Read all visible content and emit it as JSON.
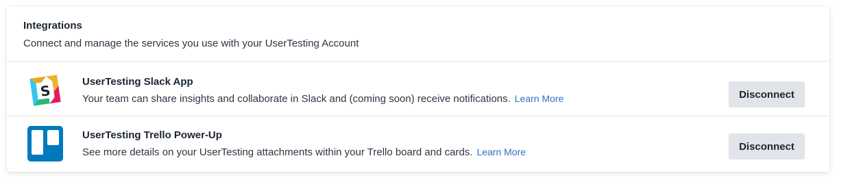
{
  "header": {
    "title": "Integrations",
    "subtitle": "Connect and manage the services you use with your UserTesting Account"
  },
  "integrations": [
    {
      "icon": "slack-icon",
      "title": "UserTesting Slack App",
      "description": "Your team can share insights and collaborate in Slack and (coming soon) receive notifications.",
      "learn_more": "Learn More",
      "action": "Disconnect"
    },
    {
      "icon": "trello-icon",
      "title": "UserTesting Trello Power-Up",
      "description": "See more details on your UserTesting attachments within your Trello board and cards.",
      "learn_more": "Learn More",
      "action": "Disconnect"
    }
  ],
  "colors": {
    "link": "#2f6fc4",
    "button_bg": "#e1e4e8",
    "trello_blue": "#0079bf"
  }
}
